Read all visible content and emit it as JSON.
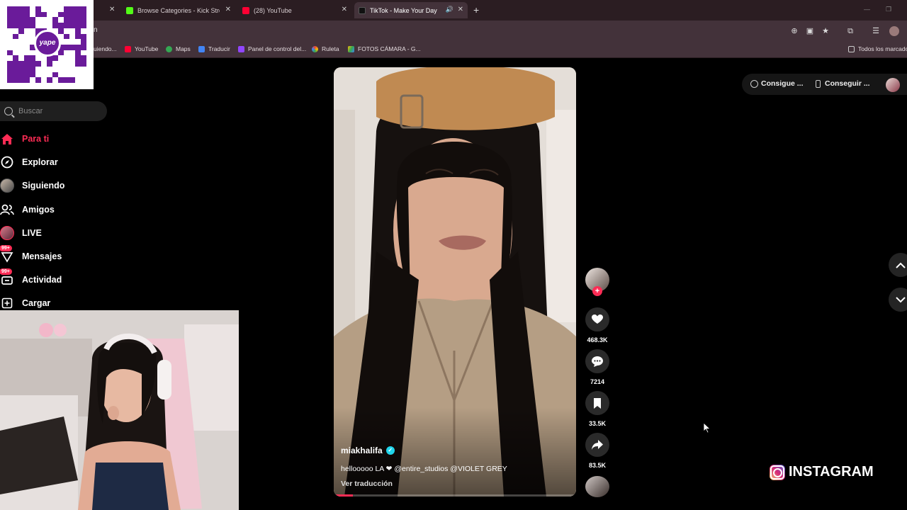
{
  "browser": {
    "tabs": [
      {
        "title": "Browse Categories - Kick Streaming",
        "favicon_color": "#53fc18",
        "close": "✕"
      },
      {
        "title": "(28) YouTube",
        "favicon_color": "#ff0033",
        "close": "✕"
      },
      {
        "title": "TikTok - Make Your Day",
        "favicon_color": "#000000",
        "close": "✕",
        "active": true,
        "audio": "🔊"
      }
    ],
    "prev_tab_close": "✕",
    "new_tab": "+",
    "url_fragment": "n",
    "bookmarks": [
      {
        "label": "uiendo...",
        "color": "#777777"
      },
      {
        "label": "YouTube",
        "color": "#ff0033"
      },
      {
        "label": "Maps",
        "color": "#34a853"
      },
      {
        "label": "Traducir",
        "color": "#4285f4"
      },
      {
        "label": "Panel de control del...",
        "color": "#9146ff"
      },
      {
        "label": "Ruleta",
        "color": "#ea4335"
      },
      {
        "label": "FOTOS CÁMARA - G...",
        "color": "#fbbc04"
      }
    ],
    "all_bookmarks": "Todos los marcadores"
  },
  "qr": {
    "logo_text": "yape",
    "color": "#6a1b9a"
  },
  "sidebar": {
    "search_placeholder": "Buscar",
    "items": [
      {
        "label": "Para ti",
        "icon": "home-icon"
      },
      {
        "label": "Explorar",
        "icon": "compass-icon"
      },
      {
        "label": "Siguiendo",
        "icon": "following-avatar-icon"
      },
      {
        "label": "Amigos",
        "icon": "friends-icon"
      },
      {
        "label": "LIVE",
        "icon": "live-avatar-icon"
      },
      {
        "label": "Mensajes",
        "icon": "messages-icon",
        "badge": "99+"
      },
      {
        "label": "Actividad",
        "icon": "activity-icon",
        "badge": "99+"
      },
      {
        "label": "Cargar",
        "icon": "upload-icon"
      }
    ]
  },
  "video": {
    "username": "miakhalifa",
    "verified_mark": "✓",
    "caption": "hellooooo LA ❤ @entire_studios @VIOLET GREY",
    "translate": "Ver traducción",
    "progress": 0.08
  },
  "actions": {
    "follow": "+",
    "likes": "468.3K",
    "comments": "7214",
    "saves": "33.5K",
    "shares": "83.5K"
  },
  "topright": {
    "coins": "Consigue ...",
    "app": "Conseguir ..."
  },
  "overlay": {
    "instagram": "INSTAGRAM"
  },
  "colors": {
    "accent": "#fe2c55",
    "verified": "#20d5ec"
  }
}
